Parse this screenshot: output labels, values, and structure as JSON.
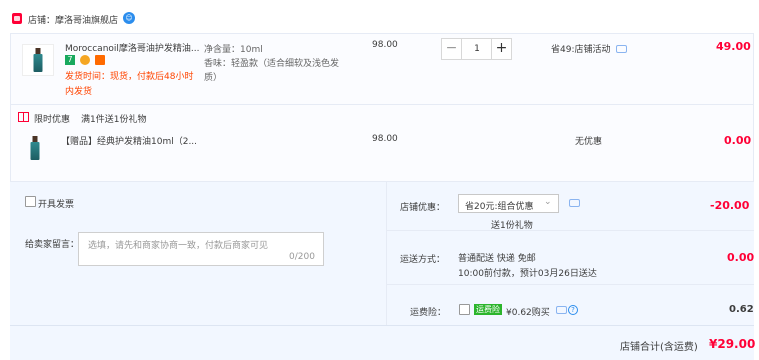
{
  "shop": {
    "label": "店铺：摩洛哥油旗舰店"
  },
  "items": [
    {
      "title": "Moroccanoil摩洛哥油护发精油...",
      "delivery_line1": "发货时间：现货，付款后48小时",
      "delivery_line2": "内发货",
      "sku_line1": "净含量：10ml",
      "sku_line2": "香味：轻盈款（适合细软及浅色发",
      "sku_line3": "质）",
      "price": "98.00",
      "quantity": "1",
      "promo": "省49:店铺活动",
      "subtotal": "49.00"
    }
  ],
  "gift_section": {
    "title": "限时优惠",
    "condition": "满1件送1份礼物",
    "item_title": "【赠品】经典护发精油10ml（2...",
    "price": "98.00",
    "promo": "无优惠",
    "subtotal": "0.00"
  },
  "invoice": {
    "label": "开具发票"
  },
  "memo": {
    "label": "给卖家留言：",
    "placeholder": "选填，请先和商家协商一致，付款后商家可见",
    "counter": "0/200"
  },
  "shop_discount": {
    "label": "店铺优惠：",
    "selected": "省20元:组合优惠",
    "note": "送1份礼物",
    "amount": "-20.00"
  },
  "shipping": {
    "label": "运送方式：",
    "line1": "普通配送 快递 免邮",
    "line2": "10:00前付款，预计03月26日送达",
    "amount": "0.00"
  },
  "insurance": {
    "label": "运费险：",
    "badge": "运费险",
    "text": "¥0.62购买",
    "amount": "0.62"
  },
  "total": {
    "label": "店铺合计(含运费)",
    "amount": "¥29.00"
  },
  "colors": {
    "price_red": "#ff0036",
    "delivery_orange": "#f40",
    "link_blue": "#2b8ded",
    "panel_bg": "#f2f7ff"
  }
}
